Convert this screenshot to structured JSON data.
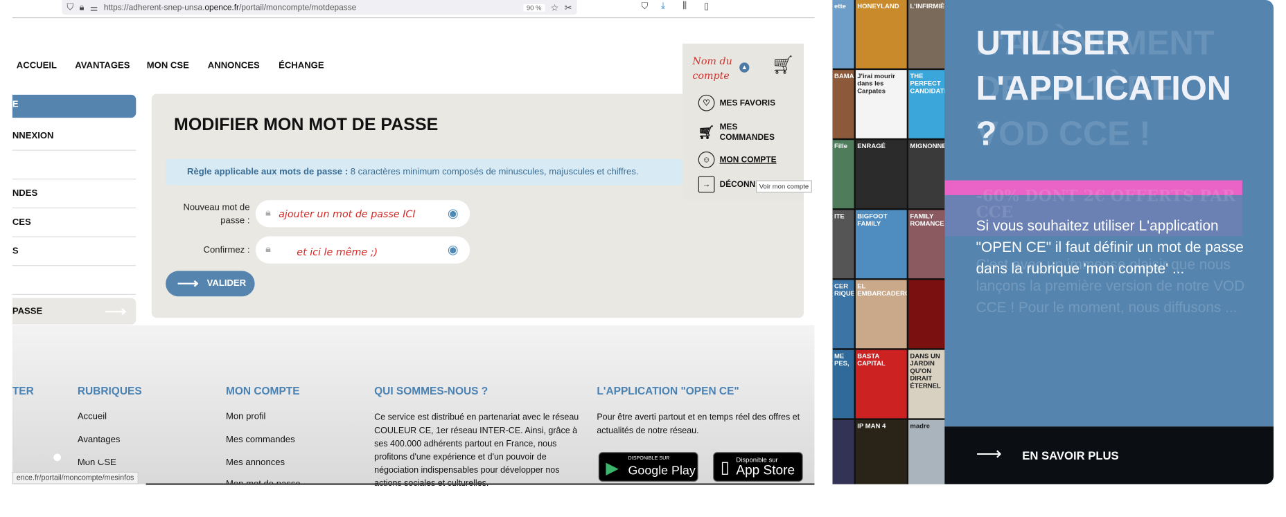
{
  "browser": {
    "url_prefix": "https://adherent-snep-unsa.",
    "url_host": "opence.fr",
    "url_path": "/portail/moncompte/motdepasse",
    "zoom": "90 %",
    "status_url": "ence.fr/portail/moncompte/mesinfos"
  },
  "nav": [
    "ACCUEIL",
    "AVANTAGES",
    "MON CSE",
    "ANNONCES",
    "ÉCHANGE"
  ],
  "account": {
    "name": "Nom du compte",
    "menu": [
      "MES FAVORIS",
      "MES COMMANDES",
      "MON COMPTE",
      "DÉCONN"
    ],
    "tooltip": "Voir mon compte"
  },
  "sidebar": {
    "active": "E",
    "items": [
      "NNEXION",
      "",
      "NDES",
      "CES",
      "S",
      ""
    ],
    "last": "PASSE"
  },
  "form": {
    "title": "MODIFIER MON MOT DE PASSE",
    "rule_label": "Règle applicable aux mots de passe :",
    "rule_text": " 8 caractères minimum composés de minuscules, majuscules et chiffres.",
    "new_label": "Nouveau mot de passe :",
    "new_value": "ajouter un mot de passe ICI",
    "confirm_label": "Confirmez :",
    "confirm_value": "et ici le même ;)",
    "submit": "VALIDER"
  },
  "footer": {
    "col0": "TER",
    "rubriques": {
      "title": "RUBRIQUES",
      "links": [
        "Accueil",
        "Avantages",
        "Mon CSE"
      ]
    },
    "compte": {
      "title": "MON COMPTE",
      "links": [
        "Mon profil",
        "Mes commandes",
        "Mes annonces",
        "Mon mot de passe"
      ]
    },
    "qui": {
      "title": "QUI SOMMES-NOUS ?",
      "text": "Ce service est distribué en partenariat avec le réseau COULEUR CE, 1er réseau INTER-CE. Ainsi, grâce à ses 400.000 adhérents partout en France, nous profitons d'une expérience et d'un pouvoir de négociation indispensables pour développer nos actions sociales et culturelles."
    },
    "app": {
      "title": "L'APPLICATION \"OPEN CE\"",
      "text": "Pour être averti partout et en temps réel des offres et actualités de notre réseau.",
      "google_small": "DISPONIBLE SUR",
      "google": "Google Play",
      "apple_small": "Disponible sur",
      "apple": "App Store"
    }
  },
  "posters": [
    "ette",
    "HONEYLAND",
    "L'INFIRMIÈRE",
    "BAMAKO",
    "J'irai mourir dans les Carpates",
    "THE PERFECT CANDIDATE",
    "Fille",
    "ENRAGÉ",
    "MIGNONNES",
    "ITE",
    "BIGFOOT FAMILY",
    "FAMILY ROMANCE",
    "CER RIQUE",
    "EL EMBARCADERO",
    "",
    "ME PES,",
    "BASTA CAPITAL",
    "DANS UN JARDIN QU'ON DIRAIT ÉTERNEL",
    "",
    "IP MAN 4",
    "madre"
  ],
  "promo": {
    "title": "UTILISER L'APPLICATION ?",
    "ghost_title": "L'AVÈNEMENT DE LA 1ÈRE VOD CCE !",
    "ghost_promo": "-60% DONT 2€ OFFERTS PAR CCE",
    "text": "Si vous souhaitez utiliser L'application \"OPEN CE\" il faut définir un mot de passe dans la rubrique 'mon compte' ...",
    "ghost_text": "C'est avec un immense plaisir que nous lançons la première version de notre VOD CCE ! Pour le moment, nous diffusons ...",
    "cta": "EN SAVOIR PLUS",
    "colors": {
      "panel": "#5584af",
      "pink": "#e964c6",
      "dark": "#0b0f14"
    }
  }
}
